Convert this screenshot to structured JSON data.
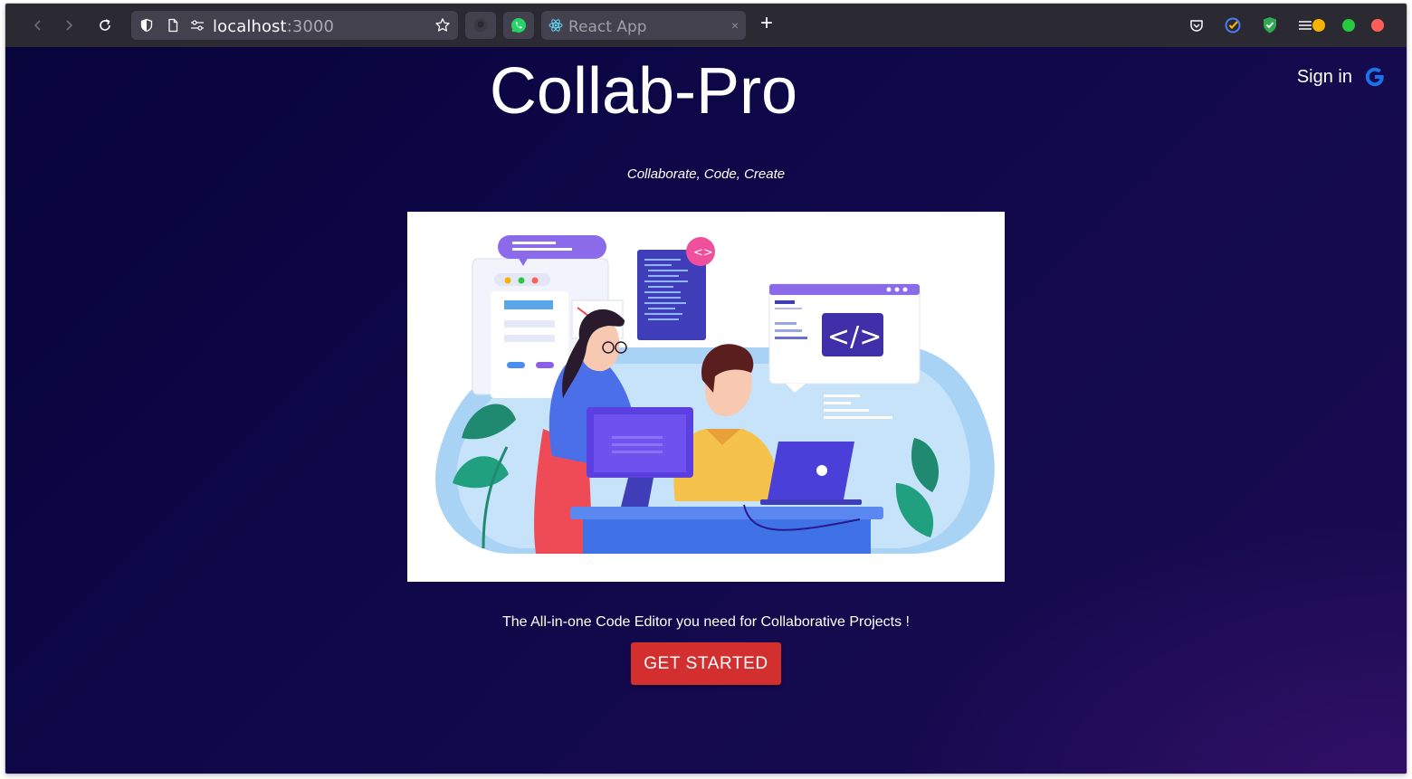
{
  "browser": {
    "url_host": "localhost",
    "url_port": ":3000",
    "tab_title": "React App",
    "tab_close": "×",
    "new_tab": "+",
    "window_dot_colors": [
      "#f5b400",
      "#27c93f",
      "#ff5f57"
    ]
  },
  "header": {
    "title": "Collab-Pro",
    "signin_label": "Sign in",
    "signin_icon": "google-icon"
  },
  "hero": {
    "tagline": "Collaborate, Code, Create",
    "image_icon": "collaboration-illustration",
    "subtext": "The All-in-one Code Editor you need for Collaborative Projects !",
    "cta_label": "GET STARTED"
  },
  "colors": {
    "cta": "#d32f2f",
    "page_background": "#0d0747",
    "toolbar": "#2b2a33"
  }
}
